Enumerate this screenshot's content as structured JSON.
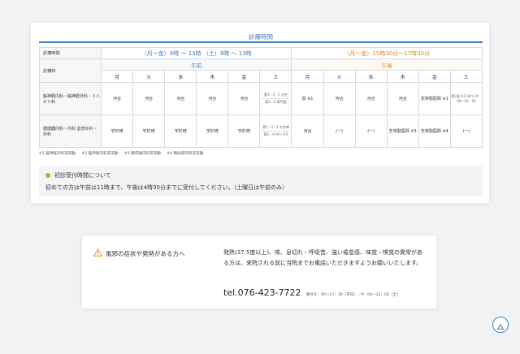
{
  "schedule": {
    "title": "診療時間",
    "hours_label": "診療時間",
    "dept_label": "診療科",
    "am_hours": "（月～金）9時 ～ 13時 （土）9時 ～ 13時",
    "pm_hours": "（月～金）15時30分～17時30分",
    "am_label": "午前",
    "pm_label": "午後",
    "days": [
      "月",
      "火",
      "水",
      "木",
      "金",
      "土"
    ],
    "row1": {
      "dept": "脳神経内科・脳神経外科・リハビリ科",
      "am": [
        "河合",
        "河合",
        "河合",
        "河合",
        "河合"
      ],
      "am_sat_top": "第1・3・5 河合",
      "am_sat_bottom": "第2・4 専門医",
      "pm": [
        "泉 ※1",
        "河合",
        "河合",
        "河合",
        "非常勤医師 ※1"
      ],
      "pm_sat": "第2週 ※2 田口 14：00～16：00"
    },
    "row2": {
      "dept": "循環器内科・内科 血管外科・外科",
      "am": [
        "宇於崎",
        "宇於崎",
        "宇於崎",
        "宇於崎",
        "宇於崎"
      ],
      "am_sat_top": "第1・3・5 宇於崎",
      "am_sat_bottom": "第2・4 中川 ※3",
      "pm": [
        "河合",
        "(一)",
        "(一)",
        "非常勤医師 ※3",
        "非常勤医師 ※4"
      ],
      "pm_sat": "(一)"
    },
    "notes": [
      "※1 脳神経外科非常勤",
      "※2 脳神経内科非常勤",
      "※3 循環器内科非常勤",
      "※4 糖尿病内科非常勤"
    ]
  },
  "first_visit": {
    "title": "初診受付時間について",
    "text": "初めての方は午前は11時まで、午後は4時30分までに受付してください。（土曜日は午前のみ）"
  },
  "fever": {
    "title": "風邪の症状や発熱がある方へ",
    "body": "発熱(37.5度以上)、咳、息切れ・呼吸苦、強い倦怠感、味覚・嗅覚の異常がある方は、来院される前に当院までお電話いただきますようお願いいたします。",
    "tel": "tel.076-423-7722",
    "tel_hours": "受付９：00～17：30（平日）／9：00～13：00（土）"
  },
  "icons": {
    "warning": "warning-icon",
    "back_to_top": "arrow-up-icon"
  },
  "colors": {
    "accent_blue": "#3d7fc0",
    "accent_orange": "#d98a1c"
  }
}
